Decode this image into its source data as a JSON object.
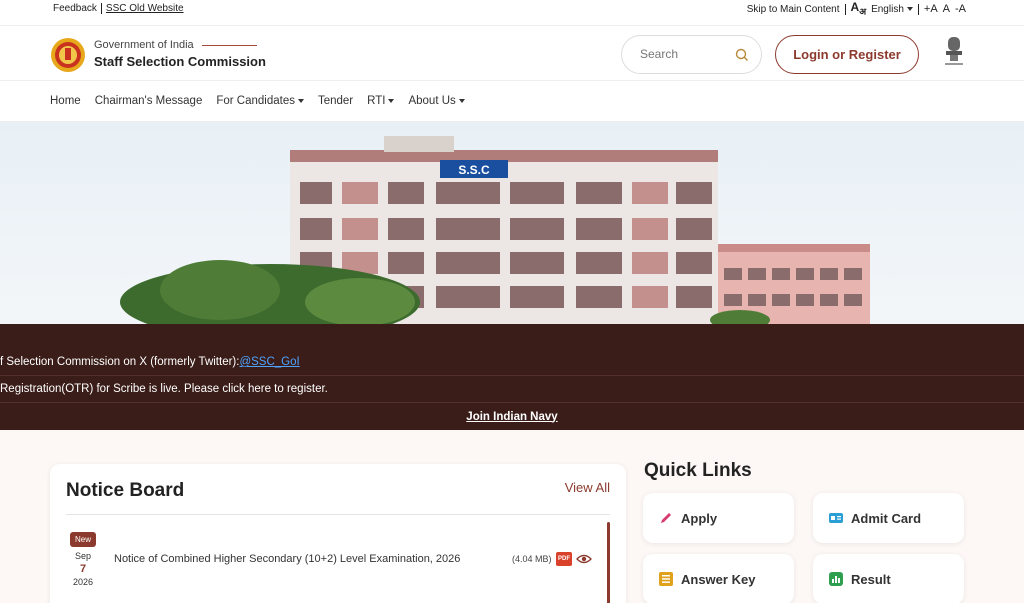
{
  "topbar": {
    "feedback": "Feedback",
    "old_website": "SSC Old Website",
    "skip": "Skip to Main Content",
    "language": "English",
    "font_increase": "+A",
    "font_normal": "A",
    "font_decrease": "-A"
  },
  "header": {
    "gov": "Government of India",
    "org": "Staff Selection Commission",
    "search_placeholder": "Search",
    "login_label": "Login or Register"
  },
  "nav": {
    "items": [
      {
        "label": "Home"
      },
      {
        "label": "Chairman's Message"
      },
      {
        "label": "For Candidates"
      },
      {
        "label": "Tender"
      },
      {
        "label": "RTI"
      },
      {
        "label": "About Us"
      }
    ]
  },
  "hero": {
    "building_sign": "S.S.C"
  },
  "ticker": {
    "line1_text": "f Selection Commission on X (formerly Twitter): ",
    "line1_link": "@SSC_GoI",
    "line2_text": "Registration(OTR) for Scribe is live. Please click here to register.",
    "line3_link": "Join Indian Navy"
  },
  "notice_board": {
    "title": "Notice Board",
    "view_all": "View All",
    "items": [
      {
        "badge": "New",
        "month": "Sep",
        "day": "7",
        "year": "2026",
        "title": "Notice of Combined Higher Secondary (10+2) Level Examination, 2026",
        "size": "(4.04 MB)",
        "file_type": "PDF"
      }
    ]
  },
  "quick_links": {
    "title": "Quick Links",
    "items": [
      {
        "label": "Apply",
        "icon": "pencil-icon",
        "color": "#d63a6f"
      },
      {
        "label": "Admit Card",
        "icon": "id-card-icon",
        "color": "#2a9fd6"
      },
      {
        "label": "Answer Key",
        "icon": "list-icon",
        "color": "#e0a21c"
      },
      {
        "label": "Result",
        "icon": "bar-chart-icon",
        "color": "#2e9e4f"
      }
    ]
  },
  "colors": {
    "brand": "#8c3a2e",
    "ticker_bg": "#3a1d18",
    "link": "#4ea3ff"
  }
}
